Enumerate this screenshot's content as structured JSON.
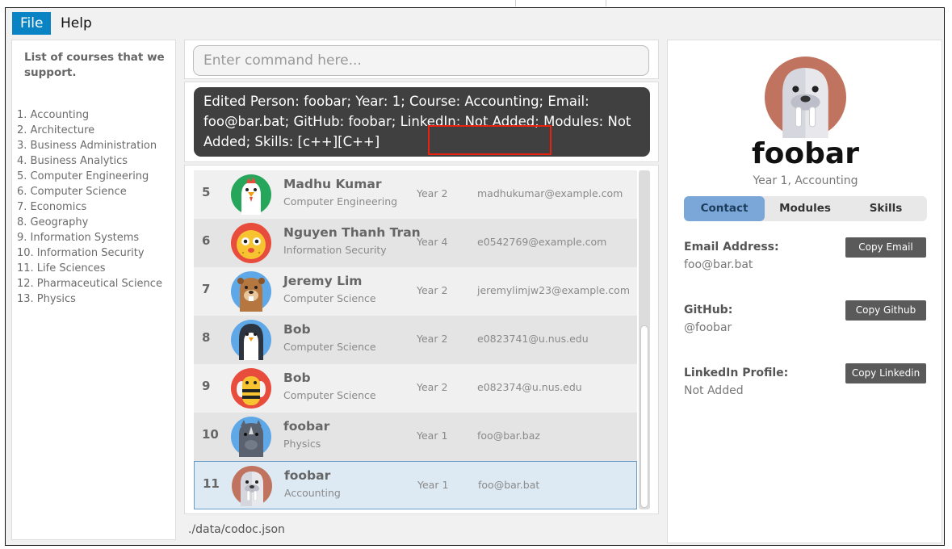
{
  "menu": {
    "file": "File",
    "help": "Help"
  },
  "sidebar": {
    "title": "List of courses that we support.",
    "courses": [
      "1. Accounting",
      "2. Architecture",
      "3. Business Administration",
      "4. Business Analytics",
      "5. Computer Engineering",
      "6. Computer Science",
      "7. Economics",
      "8. Geography",
      "9. Information Systems",
      "10. Information Security",
      "11. Life Sciences",
      "12. Pharmaceutical Science",
      "13. Physics"
    ]
  },
  "command": {
    "placeholder": "Enter command here..."
  },
  "result": {
    "text": "Edited Person: foobar; Year: 1; Course: Accounting; Email: foo@bar.bat; GitHub: foobar; LinkedIn: Not Added; Modules: Not Added; Skills: [c++][C++]"
  },
  "persons": [
    {
      "index": "5",
      "name": "Madhu Kumar",
      "course": "Computer Engineering",
      "year": "Year 2",
      "email": "madhukumar@example.com",
      "avatar": "chicken-icon"
    },
    {
      "index": "6",
      "name": "Nguyen Thanh Tran",
      "course": "Information Security",
      "year": "Year 4",
      "email": "e0542769@example.com",
      "avatar": "pufferfish-icon"
    },
    {
      "index": "7",
      "name": "Jeremy Lim",
      "course": "Computer Science",
      "year": "Year 2",
      "email": "jeremylimjw23@example.com",
      "avatar": "beaver-icon"
    },
    {
      "index": "8",
      "name": "Bob",
      "course": "Computer Science",
      "year": "Year 2",
      "email": "e0823741@u.nus.edu",
      "avatar": "penguin-icon"
    },
    {
      "index": "9",
      "name": "Bob",
      "course": "Computer Science",
      "year": "Year 2",
      "email": "e082374@u.nus.edu",
      "avatar": "bee-icon"
    },
    {
      "index": "10",
      "name": "foobar",
      "course": "Physics",
      "year": "Year 1",
      "email": "foo@bar.baz",
      "avatar": "rhino-icon"
    },
    {
      "index": "11",
      "name": "foobar",
      "course": "Accounting",
      "year": "Year 1",
      "email": "foo@bar.bat",
      "avatar": "walrus-icon"
    }
  ],
  "status": {
    "path": "./data/codoc.json"
  },
  "profile": {
    "name": "foobar",
    "subtitle": "Year 1, Accounting",
    "avatar": "walrus-icon",
    "tabs": {
      "contact": "Contact",
      "modules": "Modules",
      "skills": "Skills"
    },
    "email_label": "Email Address:",
    "email": "foo@bar.bat",
    "copy_email": "Copy Email",
    "github_label": "GitHub:",
    "github": "@foobar",
    "copy_github": "Copy Github",
    "linkedin_label": "LinkedIn Profile:",
    "linkedin": "Not Added",
    "copy_linkedin": "Copy Linkedin"
  },
  "colors": {
    "menu_active": "#0a83c4",
    "result_bg": "#404040",
    "highlight": "#e8220f",
    "tab_active": "#7aa7d8",
    "button_bg": "#5a5a5a"
  }
}
